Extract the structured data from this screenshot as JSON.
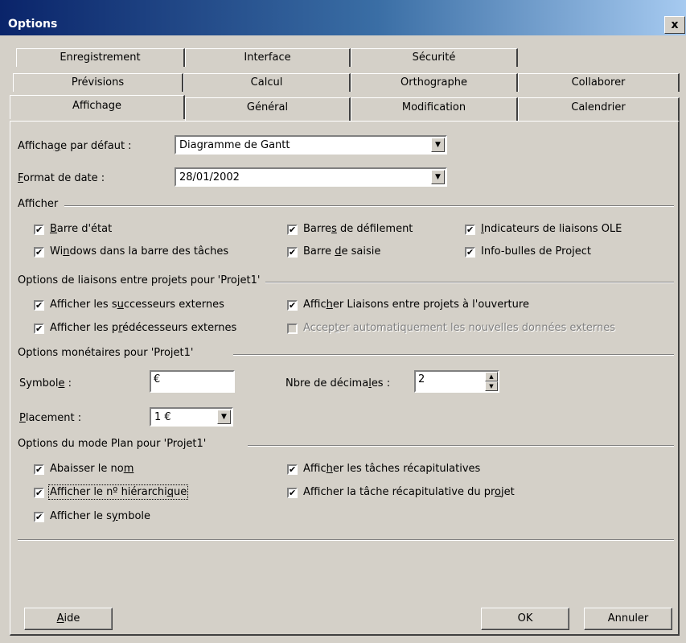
{
  "window": {
    "title": "Options",
    "close_glyph": "x"
  },
  "tabs": {
    "row1": [
      "Enregistrement",
      "Interface",
      "Sécurité"
    ],
    "row2": [
      "Prévisions",
      "Calcul",
      "Orthographe",
      "Collaborer"
    ],
    "row3": [
      "Affichage",
      "Général",
      "Modification",
      "Calendrier"
    ],
    "selected": "Affichage"
  },
  "default_view": {
    "label_pre": "Afficha",
    "label_u": "g",
    "label_post": "e par défaut :",
    "value": "Diagramme de Gantt"
  },
  "date_format": {
    "label_u": "F",
    "label_post": "ormat de date :",
    "value": "28/01/2002"
  },
  "afficher": {
    "title": "Afficher",
    "items": [
      {
        "pre": "",
        "u": "B",
        "post": "arre d'état",
        "checked": true
      },
      {
        "pre": "Barre",
        "u": "s",
        "post": " de défilement",
        "checked": true
      },
      {
        "pre": "",
        "u": "I",
        "post": "ndicateurs de liaisons OLE",
        "checked": true
      },
      {
        "pre": "Wi",
        "u": "n",
        "post": "dows dans la barre des tâches",
        "checked": true
      },
      {
        "pre": "Barre ",
        "u": "d",
        "post": "e saisie",
        "checked": true
      },
      {
        "pre": "Info-bulles de Project",
        "u": "",
        "post": "",
        "checked": true
      }
    ]
  },
  "liaisons": {
    "title": "Options de liaisons entre projets pour 'Projet1'",
    "items": [
      {
        "pre": "Afficher les s",
        "u": "u",
        "post": "ccesseurs externes",
        "checked": true
      },
      {
        "pre": "Affic",
        "u": "h",
        "post": "er Liaisons entre projets à l'ouverture",
        "checked": true
      },
      {
        "pre": "Afficher les p",
        "u": "r",
        "post": "édécesseurs externes",
        "checked": true
      },
      {
        "pre": "Accep",
        "u": "t",
        "post": "er automatiquement les nouvelles données externes",
        "checked": false
      }
    ]
  },
  "monetaires": {
    "title": "Options monétaires pour 'Projet1'",
    "symbole_pre": "Symbol",
    "symbole_u": "e",
    "symbole_post": " :",
    "symbole_value": "€",
    "decimales_pre": "Nbre de décima",
    "decimales_u": "l",
    "decimales_post": "es :",
    "decimales_value": "2",
    "placement_u": "P",
    "placement_post": "lacement :",
    "placement_value": "1 €"
  },
  "plan": {
    "title": "Options du mode Plan pour 'Projet1'",
    "items": [
      {
        "pre": "Abaisser le no",
        "u": "m",
        "post": "",
        "checked": true
      },
      {
        "pre": "Affic",
        "u": "h",
        "post": "er les tâches récapitulatives",
        "checked": true
      },
      {
        "pre": "Afficher le nº hiérarchi",
        "u": "q",
        "post": "ue",
        "checked": true
      },
      {
        "pre": "Afficher la tâche récapitulative du pr",
        "u": "o",
        "post": "jet",
        "checked": true
      },
      {
        "pre": "Afficher le s",
        "u": "y",
        "post": "mbole",
        "checked": true
      }
    ]
  },
  "buttons": {
    "aide_u": "A",
    "aide_post": "ide",
    "ok": "OK",
    "annuler": "Annuler"
  }
}
